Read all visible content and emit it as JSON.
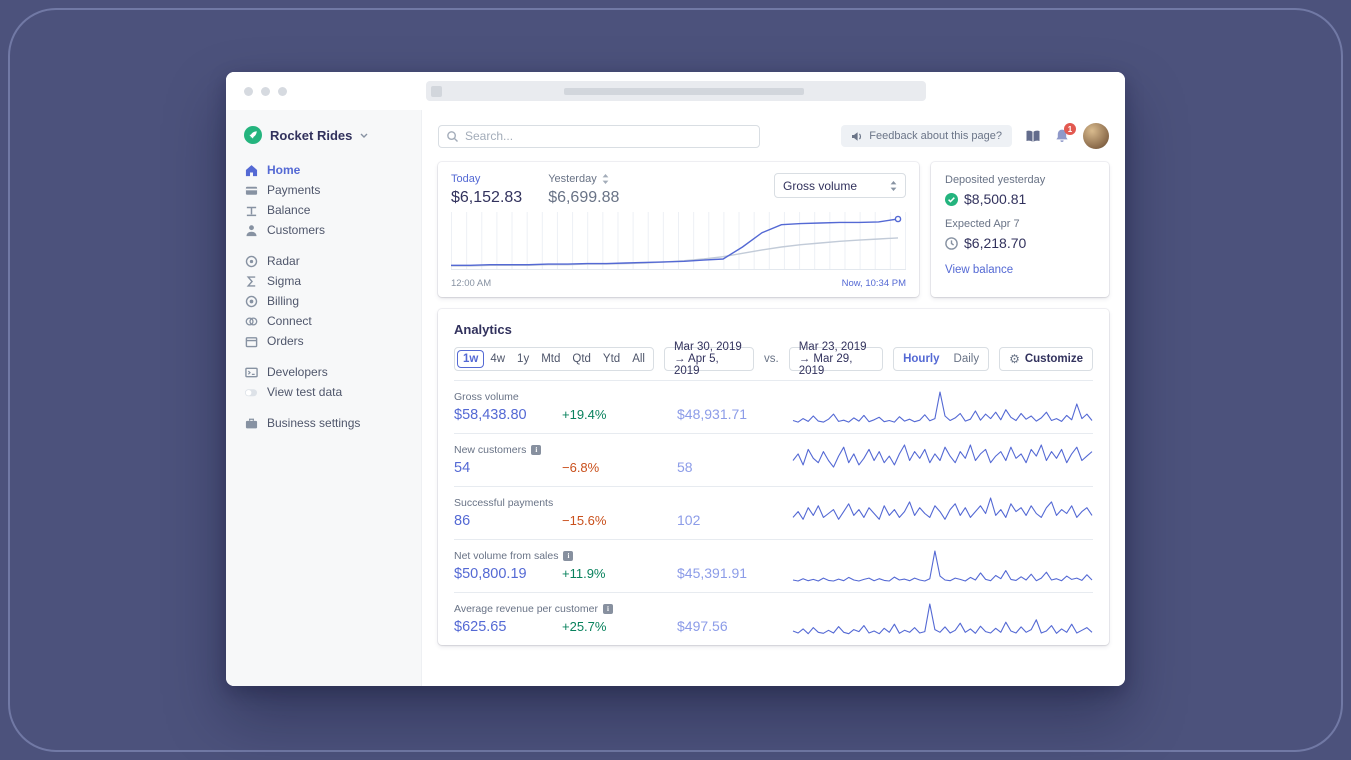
{
  "colors": {
    "accent_blue": "#5469d4",
    "secondary_blue": "#8c9ce8",
    "positive_green": "#09825d",
    "negative_orange": "#c9501c",
    "badge_red": "#e25950",
    "logo_green": "#24b47e",
    "sidebar_bg": "#f7f8f9"
  },
  "sidebar": {
    "account_name": "Rocket Rides",
    "sections": [
      {
        "items": [
          {
            "label": "Home"
          },
          {
            "label": "Payments"
          },
          {
            "label": "Balance"
          },
          {
            "label": "Customers"
          }
        ]
      },
      {
        "items": [
          {
            "label": "Radar"
          },
          {
            "label": "Sigma"
          },
          {
            "label": "Billing"
          },
          {
            "label": "Connect"
          },
          {
            "label": "Orders"
          }
        ]
      },
      {
        "items": [
          {
            "label": "Developers"
          },
          {
            "label": "View test data"
          }
        ]
      },
      {
        "items": [
          {
            "label": "Business settings"
          }
        ]
      }
    ],
    "active_item": "Home"
  },
  "topbar": {
    "search_placeholder": "Search...",
    "feedback_label": "Feedback about this page?",
    "notification_count": "1"
  },
  "overview": {
    "today_label": "Today",
    "today_value": "$6,152.83",
    "yesterday_label": "Yesterday",
    "yesterday_value": "$6,699.88",
    "metric_select_value": "Gross volume",
    "x_start": "12:00 AM",
    "x_end": "Now, 10:34 PM"
  },
  "deposits": {
    "deposited_label": "Deposited yesterday",
    "deposited_value": "$8,500.81",
    "expected_label": "Expected Apr 7",
    "expected_value": "$6,218.70",
    "link_label": "View balance"
  },
  "analytics": {
    "title": "Analytics",
    "ranges": [
      "1w",
      "4w",
      "1y",
      "Mtd",
      "Qtd",
      "Ytd",
      "All"
    ],
    "active_range": "1w",
    "date_range_1": "Mar 30, 2019 → Apr 5, 2019",
    "vs_label": "vs.",
    "date_range_2": "Mar 23, 2019 → Mar 29, 2019",
    "granularities": [
      "Hourly",
      "Daily"
    ],
    "active_granularity": "Hourly",
    "customize_label": "Customize",
    "rows": [
      {
        "label": "Gross volume",
        "has_info": false,
        "value": "$58,438.80",
        "delta": "+19.4%",
        "delta_dir": "up",
        "previous": "$48,931.71"
      },
      {
        "label": "New customers",
        "has_info": true,
        "value": "54",
        "delta": "−6.8%",
        "delta_dir": "down",
        "previous": "58"
      },
      {
        "label": "Successful payments",
        "has_info": false,
        "value": "86",
        "delta": "−15.6%",
        "delta_dir": "down",
        "previous": "102"
      },
      {
        "label": "Net volume from sales",
        "has_info": true,
        "value": "$50,800.19",
        "delta": "+11.9%",
        "delta_dir": "up",
        "previous": "$45,391.91"
      },
      {
        "label": "Average revenue per customer",
        "has_info": true,
        "value": "$625.65",
        "delta": "+25.7%",
        "delta_dir": "up",
        "previous": "$497.56"
      }
    ]
  },
  "chart_data": [
    {
      "type": "line",
      "title": "Gross volume — today vs yesterday (hourly, cumulative)",
      "x_range": [
        "12:00 AM",
        "Now, 10:34 PM"
      ],
      "grid": "vertical",
      "series": [
        {
          "name": "Today",
          "color": "#5469d4",
          "values": [
            3,
            3,
            4,
            4,
            4,
            5,
            5,
            6,
            6,
            7,
            8,
            9,
            10,
            12,
            14,
            35,
            60,
            74,
            76,
            77,
            78,
            78,
            79,
            84
          ]
        },
        {
          "name": "Yesterday",
          "color": "#c2cbd8",
          "values": [
            2,
            2,
            3,
            3,
            3,
            4,
            4,
            5,
            5,
            6,
            7,
            9,
            11,
            14,
            18,
            24,
            30,
            35,
            39,
            42,
            45,
            47,
            49,
            51
          ]
        }
      ]
    },
    {
      "type": "sparkline",
      "name": "Gross volume",
      "color": "#5469d4",
      "values": [
        8,
        3,
        14,
        5,
        22,
        6,
        3,
        12,
        28,
        5,
        9,
        3,
        16,
        6,
        24,
        4,
        10,
        18,
        4,
        8,
        3,
        20,
        6,
        12,
        4,
        9,
        26,
        7,
        14,
        98,
        22,
        8,
        16,
        30,
        6,
        12,
        38,
        9,
        28,
        14,
        34,
        10,
        42,
        18,
        8,
        30,
        12,
        22,
        6,
        16,
        34,
        8,
        14,
        5,
        24,
        10,
        60,
        14,
        28,
        8
      ]
    },
    {
      "type": "sparkline",
      "name": "New customers",
      "color": "#5469d4",
      "values": [
        35,
        50,
        25,
        60,
        40,
        30,
        55,
        35,
        20,
        45,
        65,
        30,
        50,
        25,
        40,
        60,
        35,
        55,
        30,
        45,
        25,
        50,
        70,
        35,
        55,
        40,
        60,
        30,
        50,
        35,
        65,
        45,
        30,
        55,
        40,
        70,
        35,
        50,
        60,
        30,
        45,
        55,
        35,
        65,
        40,
        50,
        30,
        60,
        45,
        70,
        35,
        55,
        40,
        60,
        30,
        50,
        65,
        35,
        45,
        55
      ]
    },
    {
      "type": "sparkline",
      "name": "Successful payments",
      "color": "#5469d4",
      "values": [
        30,
        45,
        25,
        55,
        35,
        60,
        30,
        40,
        50,
        25,
        45,
        65,
        35,
        50,
        30,
        55,
        40,
        25,
        60,
        35,
        50,
        30,
        45,
        70,
        35,
        55,
        40,
        30,
        60,
        45,
        25,
        50,
        65,
        35,
        55,
        30,
        45,
        60,
        40,
        80,
        35,
        50,
        30,
        65,
        45,
        55,
        35,
        60,
        40,
        30,
        55,
        70,
        35,
        50,
        40,
        60,
        30,
        45,
        55,
        35
      ]
    },
    {
      "type": "sparkline",
      "name": "Net volume from sales",
      "color": "#5469d4",
      "values": [
        6,
        3,
        10,
        4,
        8,
        3,
        12,
        5,
        3,
        9,
        4,
        14,
        6,
        3,
        8,
        12,
        4,
        10,
        5,
        3,
        15,
        6,
        9,
        4,
        12,
        6,
        3,
        10,
        95,
        18,
        6,
        4,
        12,
        8,
        3,
        14,
        6,
        28,
        8,
        4,
        20,
        10,
        35,
        8,
        5,
        16,
        6,
        24,
        4,
        12,
        30,
        6,
        10,
        4,
        18,
        8,
        12,
        5,
        22,
        6
      ]
    },
    {
      "type": "sparkline",
      "name": "Average revenue per customer",
      "color": "#5469d4",
      "values": [
        12,
        6,
        18,
        4,
        22,
        8,
        5,
        14,
        6,
        25,
        8,
        4,
        16,
        10,
        28,
        6,
        12,
        4,
        20,
        8,
        32,
        5,
        14,
        8,
        22,
        6,
        10,
        92,
        16,
        8,
        24,
        6,
        14,
        35,
        8,
        18,
        5,
        26,
        10,
        6,
        20,
        8,
        38,
        12,
        6,
        24,
        8,
        16,
        45,
        6,
        12,
        28,
        5,
        18,
        8,
        32,
        6,
        14,
        22,
        8
      ]
    }
  ]
}
